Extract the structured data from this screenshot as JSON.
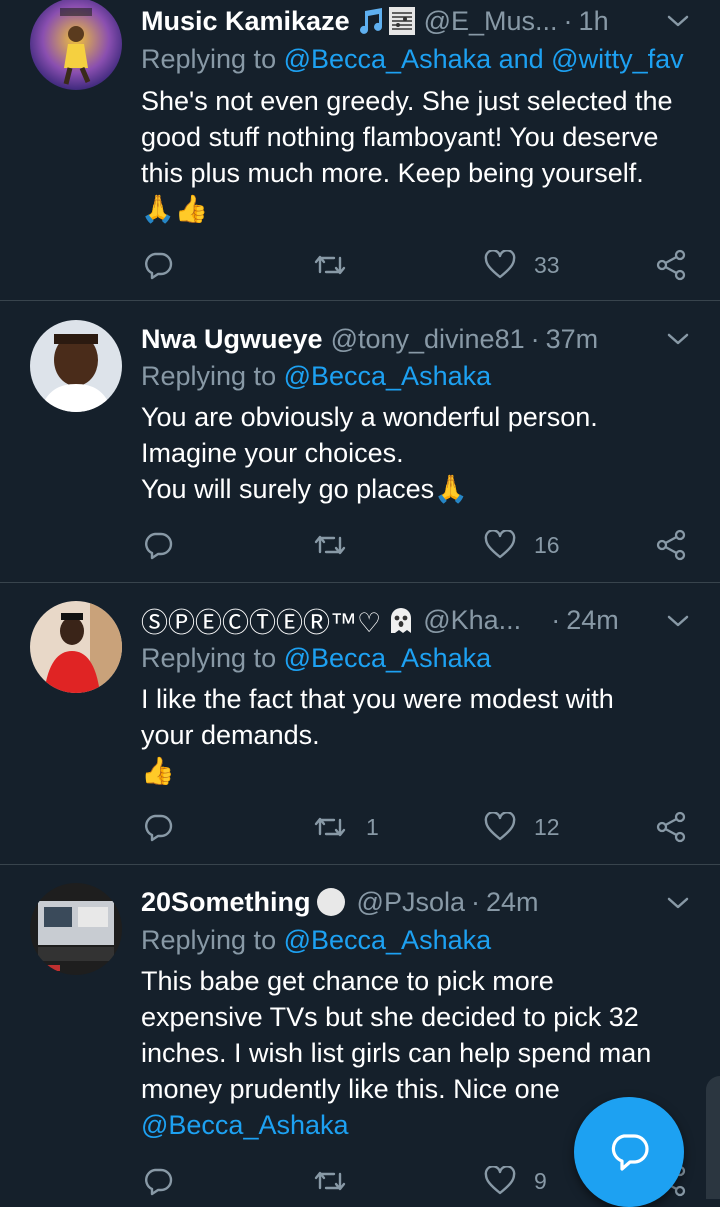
{
  "tweets": [
    {
      "name": "Music Kamikaze",
      "handle": "@E_Mus...",
      "time": "1h",
      "replying_prefix": "Replying to ",
      "replying_mentions": "@Becca_Ashaka and @witty_fav",
      "body": "She's not even greedy. She just selected the good stuff nothing flamboyant! You deserve this plus much more. Keep being yourself.",
      "body_emoji": "🙏👍",
      "retweets": "",
      "likes": "33",
      "name_emoji_icons": [
        "music-note-icon",
        "sheet-music-icon"
      ]
    },
    {
      "name": "Nwa Ugwueye",
      "handle": "@tony_divine81",
      "time": "37m",
      "replying_prefix": "Replying to ",
      "replying_mentions": "@Becca_Ashaka",
      "body_lines": [
        "You are obviously a wonderful person.",
        "Imagine your choices.",
        "You will surely go places"
      ],
      "body_emoji": "🙏",
      "retweets": "",
      "likes": "16"
    },
    {
      "name": "ⓈⓅⒺⒸⓉⒺⓇ™♡",
      "handle": "@Kha...",
      "time": "24m",
      "replying_prefix": "Replying to ",
      "replying_mentions": "@Becca_Ashaka",
      "body_lines": [
        "I like the fact that you were modest with",
        "your demands."
      ],
      "body_emoji": "👍",
      "retweets": "1",
      "likes": "12",
      "name_emoji_icons": [
        "ghost-icon"
      ]
    },
    {
      "name": "20Something",
      "handle": "@PJsola",
      "time": "24m",
      "replying_prefix": "Replying to ",
      "replying_mentions": "@Becca_Ashaka",
      "body_lines": [
        "This babe get chance to pick more",
        "expensive TVs but she decided to pick 32",
        "inches. I wish list girls can help spend man",
        "money prudently like this. Nice one"
      ],
      "body_mention": "@Becca_Ashaka",
      "retweets": "",
      "likes": "9",
      "name_emoji_icons": [
        "white-circle-icon"
      ]
    }
  ],
  "colors": {
    "background": "#15202b",
    "accent": "#1da1f2",
    "secondary_text": "#8899a6",
    "divider": "#38444d"
  },
  "fab_icon": "compose-reply-icon"
}
